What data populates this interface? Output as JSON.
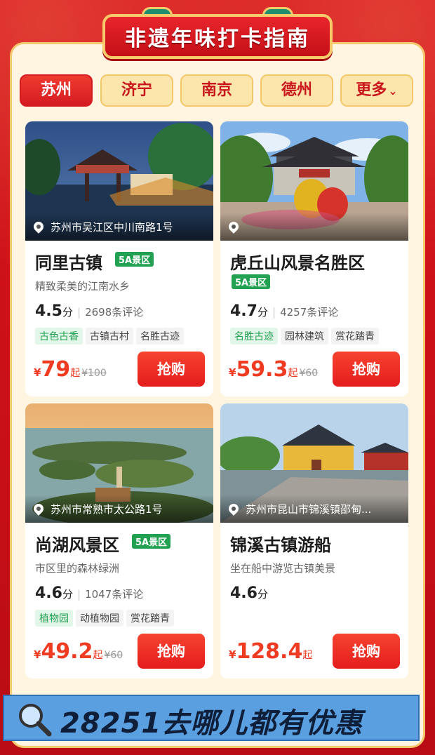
{
  "banner": {
    "title": "非遗年味打卡指南"
  },
  "tabs": [
    {
      "label": "苏州",
      "active": true
    },
    {
      "label": "济宁",
      "active": false
    },
    {
      "label": "南京",
      "active": false
    },
    {
      "label": "德州",
      "active": false
    },
    {
      "label": "更多",
      "active": false
    }
  ],
  "cards": [
    {
      "address": "苏州市吴江区中川南路1号",
      "name": "同里古镇",
      "badge": "5A景区",
      "desc": "精致柔美的江南水乡",
      "score": "4.5",
      "score_unit": "分",
      "reviews": "2698条评论",
      "tags": [
        "古色古香",
        "古镇古村",
        "名胜古迹"
      ],
      "price_symbol": "¥",
      "price": "79",
      "price_suffix": "起",
      "original_price": "¥100",
      "buy_label": "抢购"
    },
    {
      "address": "",
      "name": "虎丘山风景名胜区",
      "badge": "5A景区",
      "score": "4.7",
      "score_unit": "分",
      "reviews": "4257条评论",
      "tags": [
        "名胜古迹",
        "园林建筑",
        "赏花踏青"
      ],
      "price_symbol": "¥",
      "price": "59.3",
      "price_suffix": "起",
      "original_price": "¥60",
      "buy_label": "抢购"
    },
    {
      "address": "苏州市常熟市太公路1号",
      "name": "尚湖风景区",
      "badge": "5A景区",
      "desc": "市区里的森林绿洲",
      "score": "4.6",
      "score_unit": "分",
      "reviews": "1047条评论",
      "tags": [
        "植物园",
        "动植物园",
        "赏花踏青"
      ],
      "price_symbol": "¥",
      "price": "49.2",
      "price_suffix": "起",
      "original_price": "¥60",
      "buy_label": "抢购"
    },
    {
      "address": "苏州市昆山市锦溪镇邵甸...",
      "name": "锦溪古镇游船",
      "desc": "坐在船中游览古镇美景",
      "score": "4.6",
      "score_unit": "分",
      "price_symbol": "¥",
      "price": "128.4",
      "price_suffix": "起",
      "buy_label": "抢购"
    }
  ],
  "footer": {
    "text": "28251去哪儿都有优惠"
  },
  "colors": {
    "brand_red": "#d51b21",
    "price_red": "#ef3b22",
    "badge_green": "#23a152",
    "cream": "#fff5e1"
  }
}
